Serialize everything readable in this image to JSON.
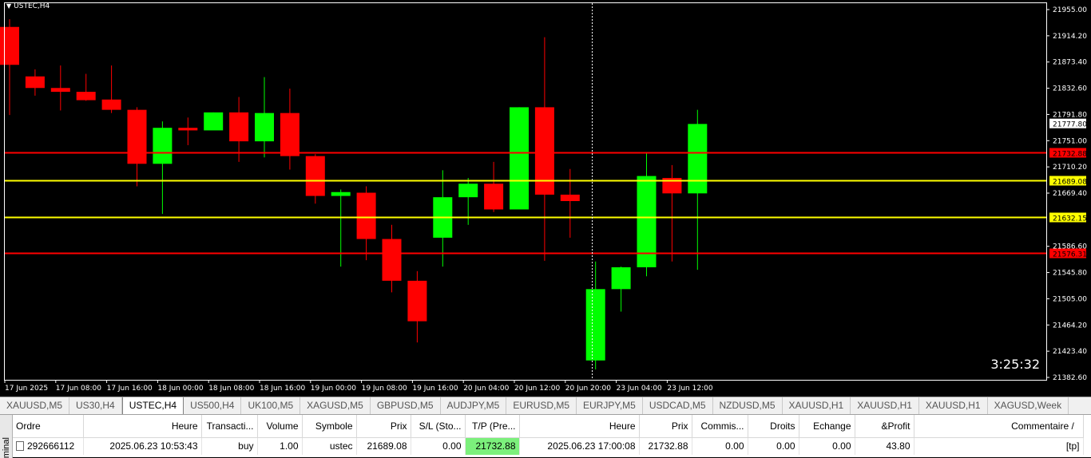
{
  "chart": {
    "symbol": "USTEC,H4",
    "timer": "3:25:32",
    "price_axis": [
      "21955.00",
      "21914.20",
      "21873.40",
      "21832.60",
      "21791.80",
      "21751.00",
      "21710.20",
      "21669.40",
      "21586.60",
      "21545.80",
      "21505.00",
      "21464.20",
      "21423.40",
      "21382.60"
    ],
    "time_axis": [
      "17 Jun 2025",
      "17 Jun 08:00",
      "17 Jun 16:00",
      "18 Jun 00:00",
      "18 Jun 08:00",
      "18 Jun 16:00",
      "19 Jun 00:00",
      "19 Jun 08:00",
      "19 Jun 16:00",
      "20 Jun 04:00",
      "20 Jun 12:00",
      "20 Jun 20:00",
      "23 Jun 04:00",
      "23 Jun 12:00"
    ],
    "current_price": "21777.80",
    "levels": [
      {
        "price": 21732.88,
        "label": "21732.88",
        "color": "#ff0000",
        "label_bg": "#ff0000",
        "label_fg": "#000000"
      },
      {
        "price": 21689.08,
        "label": "21689.08",
        "color": "#ffff00",
        "label_bg": "#ffff00",
        "label_fg": "#000000"
      },
      {
        "price": 21632.15,
        "label": "21632.15",
        "color": "#ffff00",
        "label_bg": "#ffff00",
        "label_fg": "#000000"
      },
      {
        "price": 21576.31,
        "label": "21576.31",
        "color": "#ff0000",
        "label_bg": "#ff0000",
        "label_fg": "#000000"
      }
    ],
    "colors": {
      "bull": "#00ff00",
      "bear": "#ff0000",
      "background": "#000000",
      "axis_text": "#ffffff"
    }
  },
  "chart_data": {
    "type": "candlestick",
    "series": [
      {
        "name": "USTEC,H4",
        "ohlc": [
          [
            21928,
            21940,
            21791,
            21869
          ],
          [
            21851,
            21862,
            21821,
            21833
          ],
          [
            21833,
            21868,
            21798,
            21827
          ],
          [
            21827,
            21855,
            21813,
            21814
          ],
          [
            21815,
            21868,
            21794,
            21799
          ],
          [
            21799,
            21803,
            21680,
            21715
          ],
          [
            21715,
            21781,
            21637,
            21771
          ],
          [
            21771,
            21787,
            21744,
            21767
          ],
          [
            21767,
            21795,
            21769,
            21795
          ],
          [
            21795,
            21819,
            21718,
            21750
          ],
          [
            21750,
            21850,
            21725,
            21794
          ],
          [
            21794,
            21832,
            21706,
            21727
          ],
          [
            21727,
            21730,
            21653,
            21665
          ],
          [
            21665,
            21675,
            21555,
            21671
          ],
          [
            21670,
            21680,
            21565,
            21598
          ],
          [
            21598,
            21620,
            21515,
            21533
          ],
          [
            21533,
            21548,
            21437,
            21470
          ],
          [
            21600,
            21705,
            21555,
            21663
          ],
          [
            21663,
            21693,
            21620,
            21684
          ],
          [
            21684,
            21718,
            21640,
            21644
          ],
          [
            21644,
            21803,
            21680,
            21803
          ],
          [
            21803,
            21912,
            21564,
            21667
          ],
          [
            21667,
            21707,
            21600,
            21657
          ],
          [
            21409,
            21563,
            21395,
            21520
          ],
          [
            21520,
            21555,
            21485,
            21554
          ],
          [
            21554,
            21731,
            21540,
            21696
          ],
          [
            21693,
            21713,
            21563,
            21669
          ],
          [
            21669,
            21799,
            21550,
            21777
          ]
        ]
      }
    ],
    "ylim": [
      21382.6,
      21955.0
    ]
  },
  "tabs": [
    "XAUUSD,M5",
    "US30,H4",
    "USTEC,H4",
    "US500,H4",
    "UK100,M5",
    "XAGUSD,M5",
    "GBPUSD,M5",
    "AUDJPY,M5",
    "EURUSD,M5",
    "EURJPY,M5",
    "USDCAD,M5",
    "NZDUSD,M5",
    "XAUUSD,H1",
    "XAUUSD,H1",
    "XAUUSD,H1",
    "XAGUSD,Week"
  ],
  "active_tab": 2,
  "terminal": {
    "side_label": "minal",
    "headers": [
      "Ordre",
      "Heure",
      "Transacti...",
      "Volume",
      "Symbole",
      "Prix",
      "S/L (Sto...",
      "T/P (Pre...",
      "Heure",
      "Prix",
      "Commis...",
      "Droits",
      "Echange",
      "&Profit",
      "Commentaire"
    ],
    "sort_glyph": "/",
    "row": [
      "292666112",
      "2025.06.23 10:53:43",
      "buy",
      "1.00",
      "ustec",
      "21689.08",
      "0.00",
      "21732.88",
      "2025.06.23 17:00:08",
      "21732.88",
      "0.00",
      "0.00",
      "0.00",
      "43.80",
      "[tp]"
    ]
  }
}
